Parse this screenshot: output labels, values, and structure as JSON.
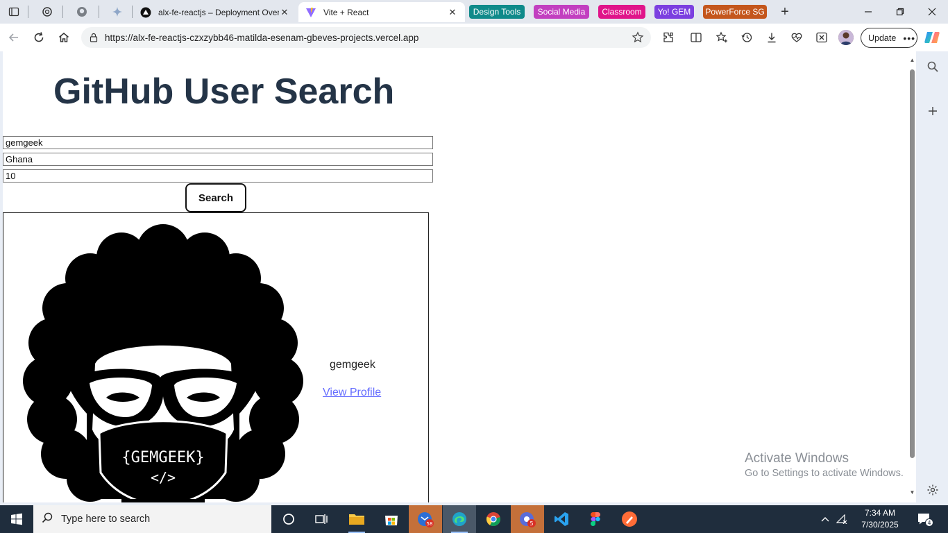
{
  "browser": {
    "tabs": [
      {
        "title": "alx-fe-reactjs – Deployment Overv",
        "active": false
      },
      {
        "title": "Vite + React",
        "active": true
      }
    ],
    "tab_groups": [
      {
        "label": "Design Tools",
        "color": "#0f8a8a"
      },
      {
        "label": "Social Media",
        "color": "#c23fc0"
      },
      {
        "label": "Classroom",
        "color": "#e0148a"
      },
      {
        "label": "Yo! GEM",
        "color": "#7b3fe0"
      },
      {
        "label": "PowerForce SG",
        "color": "#c4561c"
      }
    ],
    "url": "https://alx-fe-reactjs-czxzybb46-matilda-esenam-gbeves-projects.vercel.app",
    "update_label": "Update"
  },
  "page": {
    "title": "GitHub User Search",
    "inputs": {
      "username": "gemgeek",
      "location": "Ghana",
      "min_repos": "10"
    },
    "search_label": "Search",
    "result": {
      "username": "gemgeek",
      "link_label": "View Profile",
      "avatar_text_1": "{GEMGEEK}",
      "avatar_text_2": "</>"
    }
  },
  "watermark": {
    "title": "Activate Windows",
    "subtitle": "Go to Settings to activate Windows."
  },
  "taskbar": {
    "search_placeholder": "Type here to search",
    "time": "7:34 AM",
    "date": "7/30/2025",
    "teams_badge": "58",
    "chrome_badge": "5",
    "notification_count": "4"
  },
  "colors": {
    "title": "#243447",
    "link": "#646cff",
    "taskbar": "#1f2d3d"
  }
}
